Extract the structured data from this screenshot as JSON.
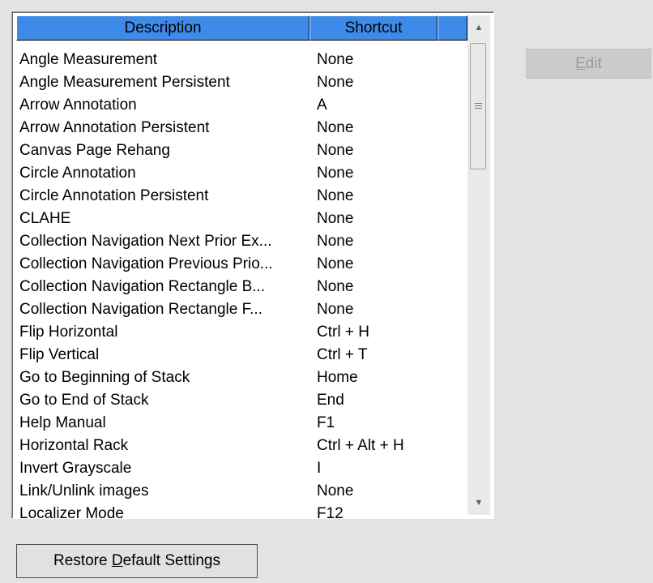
{
  "shortcuts_table": {
    "columns": [
      "Description",
      "Shortcut",
      ""
    ],
    "rows": [
      {
        "description": "Angle Measurement",
        "shortcut": "None"
      },
      {
        "description": "Angle Measurement Persistent",
        "shortcut": "None"
      },
      {
        "description": "Arrow Annotation",
        "shortcut": "A"
      },
      {
        "description": "Arrow Annotation Persistent",
        "shortcut": "None"
      },
      {
        "description": "Canvas Page Rehang",
        "shortcut": "None"
      },
      {
        "description": "Circle Annotation",
        "shortcut": "None"
      },
      {
        "description": "Circle Annotation Persistent",
        "shortcut": "None"
      },
      {
        "description": "CLAHE",
        "shortcut": "None"
      },
      {
        "description": "Collection Navigation Next Prior Ex...",
        "shortcut": "None"
      },
      {
        "description": "Collection Navigation Previous Prio...",
        "shortcut": "None"
      },
      {
        "description": "Collection Navigation Rectangle B...",
        "shortcut": "None"
      },
      {
        "description": "Collection Navigation Rectangle F...",
        "shortcut": "None"
      },
      {
        "description": "Flip Horizontal",
        "shortcut": "Ctrl + H"
      },
      {
        "description": "Flip Vertical",
        "shortcut": "Ctrl + T"
      },
      {
        "description": "Go to Beginning of Stack",
        "shortcut": "Home"
      },
      {
        "description": "Go to End of Stack",
        "shortcut": "End"
      },
      {
        "description": "Help Manual",
        "shortcut": "F1"
      },
      {
        "description": "Horizontal Rack",
        "shortcut": "Ctrl + Alt + H"
      },
      {
        "description": "Invert Grayscale",
        "shortcut": "I"
      },
      {
        "description": "Link/Unlink images",
        "shortcut": "None"
      },
      {
        "description": "Localizer Mode",
        "shortcut": "F12"
      }
    ]
  },
  "scrollbar": {
    "up_arrow_icon": "triangle-up",
    "down_arrow_icon": "triangle-down",
    "position_fraction": 0.0
  },
  "buttons": {
    "edit": {
      "label_pre": "",
      "mnemonic": "E",
      "label_post": "dit",
      "enabled": false
    },
    "restore": {
      "label_pre": "Restore ",
      "mnemonic": "D",
      "label_post": "efault Settings",
      "enabled": true
    }
  },
  "colors": {
    "header_background": "#3d8ae9",
    "window_background": "#e3e3e3",
    "disabled_text": "#9a9a9a"
  }
}
